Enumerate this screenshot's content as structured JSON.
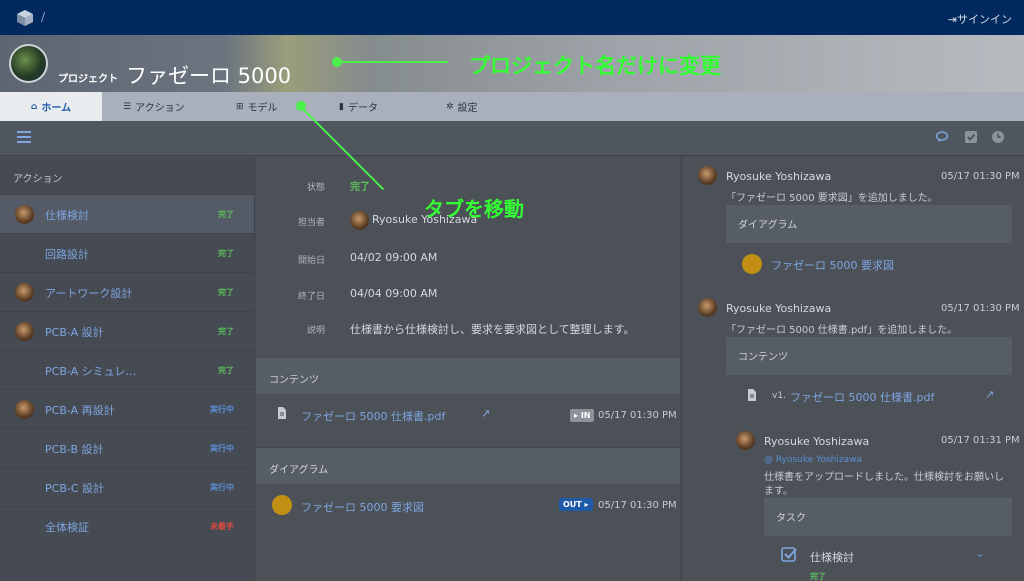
{
  "topbar": {
    "slash": "/",
    "signin": "サインイン"
  },
  "header": {
    "project_label": "プロジェクト",
    "project_name": "ファゼーロ 5000"
  },
  "annotations": {
    "rename": "プロジェクト名だけに変更",
    "move_tabs": "タブを移動"
  },
  "tabs": [
    {
      "label": "ホーム"
    },
    {
      "label": "アクション"
    },
    {
      "label": "モデル"
    },
    {
      "label": "データ"
    },
    {
      "label": "設定"
    }
  ],
  "sidebar": {
    "heading": "アクション",
    "items": [
      {
        "name": "仕様検討",
        "status": "完了"
      },
      {
        "name": "回路設計",
        "status": "完了"
      },
      {
        "name": "アートワーク設計",
        "status": "完了"
      },
      {
        "name": "PCB-A 設計",
        "status": "完了"
      },
      {
        "name": "PCB-A シミュレ…",
        "status": "完了"
      },
      {
        "name": "PCB-A 再設計",
        "status": "実行中"
      },
      {
        "name": "PCB-B 設計",
        "status": "実行中"
      },
      {
        "name": "PCB-C 設計",
        "status": "実行中"
      },
      {
        "name": "全体検証",
        "status": "未着手"
      }
    ]
  },
  "detail": {
    "status_label": "状態",
    "status_value": "完了",
    "assignee_label": "担当者",
    "assignee_value": "Ryosuke Yoshizawa",
    "start_label": "開始日",
    "start_value": "04/02 09:00 AM",
    "end_label": "終了日",
    "end_value": "04/04 09:00 AM",
    "desc_label": "説明",
    "desc_value": "仕様書から仕様検討し、要求を要求図として整理します。"
  },
  "contents": {
    "heading": "コンテンツ",
    "file": "ファゼーロ 5000 仕様書.pdf",
    "tag": "IN",
    "time": "05/17 01:30 PM"
  },
  "diagrams": {
    "heading": "ダイアグラム",
    "file": "ファゼーロ 5000 要求図",
    "tag": "OUT",
    "time": "05/17 01:30 PM"
  },
  "feed": [
    {
      "user": "Ryosuke Yoshizawa",
      "time": "05/17 01:30 PM",
      "msg": "「ファゼーロ 5000 要求図」を追加しました。",
      "box": "ダイアグラム",
      "item": "ファゼーロ 5000 要求図"
    },
    {
      "user": "Ryosuke Yoshizawa",
      "time": "05/17 01:30 PM",
      "msg": "「ファゼーロ 5000 仕様書.pdf」を追加しました。",
      "box": "コンテンツ",
      "version": "v1.",
      "item": "ファゼーロ 5000 仕様書.pdf"
    },
    {
      "user": "Ryosuke Yoshizawa",
      "time": "05/17 01:31 PM",
      "mention": "@ Ryosuke Yoshizawa",
      "msg1": "仕様書をアップロードしました。仕様検討をお願いし",
      "msg2": "ます。",
      "box": "タスク",
      "task": "仕様検討",
      "task_status": "完了"
    }
  ],
  "colors": {
    "accent": "#33ff33",
    "link": "#7ea5e0",
    "done": "#5bbf5b",
    "running": "#5a8fd6",
    "notstarted": "#e04a3a"
  }
}
